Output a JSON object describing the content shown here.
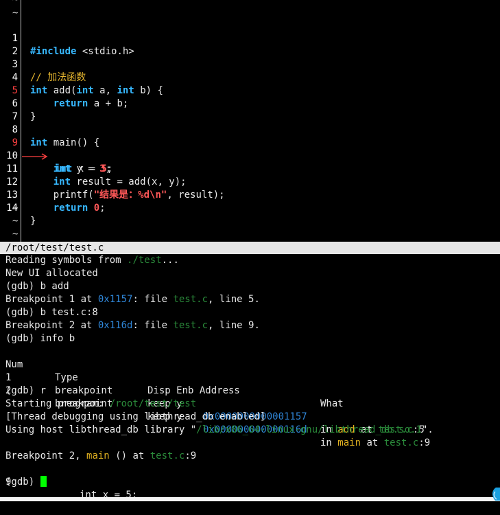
{
  "source": {
    "tilde": "~",
    "lines": [
      {
        "n": "1",
        "include": "#include",
        "header": " <stdio.h>"
      },
      {
        "n": "2"
      },
      {
        "n": "3",
        "comment": "// 加法函数"
      },
      {
        "n": "4",
        "k1": "int",
        "t1": " add(",
        "k2": "int",
        "t2": " a, ",
        "k3": "int",
        "t3": " b) {"
      },
      {
        "n": "5",
        "indent": "    ",
        "k1": "return",
        "t1": " a + b;"
      },
      {
        "n": "6",
        "t1": "}"
      },
      {
        "n": "7"
      },
      {
        "n": "8",
        "k1": "int",
        "t1": " main() {"
      },
      {
        "n": "9",
        "k1": "int",
        "t1": " x = ",
        "num": "5",
        "t2": ";"
      },
      {
        "n": "10",
        "indent": "    ",
        "k1": "int",
        "t1": " y = ",
        "num": "3",
        "t2": ";"
      },
      {
        "n": "11",
        "indent": "    ",
        "k1": "int",
        "t1": " result = add(x, y);"
      },
      {
        "n": "12",
        "indent": "    ",
        "t1": "printf(",
        "str": "\"结果是：%d\\n\"",
        "t2": ", result);"
      },
      {
        "n": "13",
        "indent": "    ",
        "k1": "return",
        "t1": " ",
        "num": "0",
        "t2": ";"
      },
      {
        "n": "14",
        "t1": "}"
      }
    ]
  },
  "status_bar": {
    "file": "/root/test/test.c"
  },
  "console": {
    "l1_a": "Reading symbols from ",
    "l1_path": "./test",
    "l1_b": "...",
    "l2": "New UI allocated",
    "l3": "(gdb) b add",
    "l4_a": "Breakpoint 1 at ",
    "l4_addr": "0x1157",
    "l4_b": ": file ",
    "l4_file": "test.c",
    "l4_c": ", line 5.",
    "l5": "(gdb) b test.c:8",
    "l6_a": "Breakpoint 2 at ",
    "l6_addr": "0x116d",
    "l6_b": ": file ",
    "l6_file": "test.c",
    "l6_c": ", line 9.",
    "l7": "(gdb) info b",
    "table": {
      "headers": [
        "Num",
        "Type",
        "Disp Enb Address",
        "What"
      ],
      "rows": [
        {
          "num": "1",
          "type": "breakpoint",
          "disp": "keep y",
          "addr": "0x0000000000001157",
          "in": "in ",
          "func": "add",
          "at": " at ",
          "file": "test.c",
          "line": ":5"
        },
        {
          "num": "2",
          "type": "breakpoint",
          "disp": "keep y",
          "addr": "0x000000000000116d",
          "in": "in ",
          "func": "main",
          "at": " at ",
          "file": "test.c",
          "line": ":9"
        }
      ]
    },
    "l10": "(gdb) r",
    "l11_a": "Starting program: ",
    "l11_path": "/root/test/test",
    "l12": "[Thread debugging using libthread_db enabled]",
    "l13_a": "Using host libthread_db library \"",
    "l13_path": "/lib/x86_64-linux-gnu/libthread_db.so.1",
    "l13_b": "\".",
    "l15_a": "Breakpoint 2, ",
    "l15_func": "main",
    "l15_b": " () at ",
    "l15_file": "test.c",
    "l15_c": ":9",
    "l16_num": "9",
    "l16_code": "int x = 5;",
    "prompt": "(gdb) "
  },
  "colors": {
    "keyword": "#37b8ff",
    "literal": "#ff5858",
    "comment": "#e8b830",
    "path": "#2a8a3a",
    "address": "#2f86d8",
    "function": "#e0b020",
    "cursor": "#00ff00",
    "status_bg": "#e6e6e6"
  }
}
